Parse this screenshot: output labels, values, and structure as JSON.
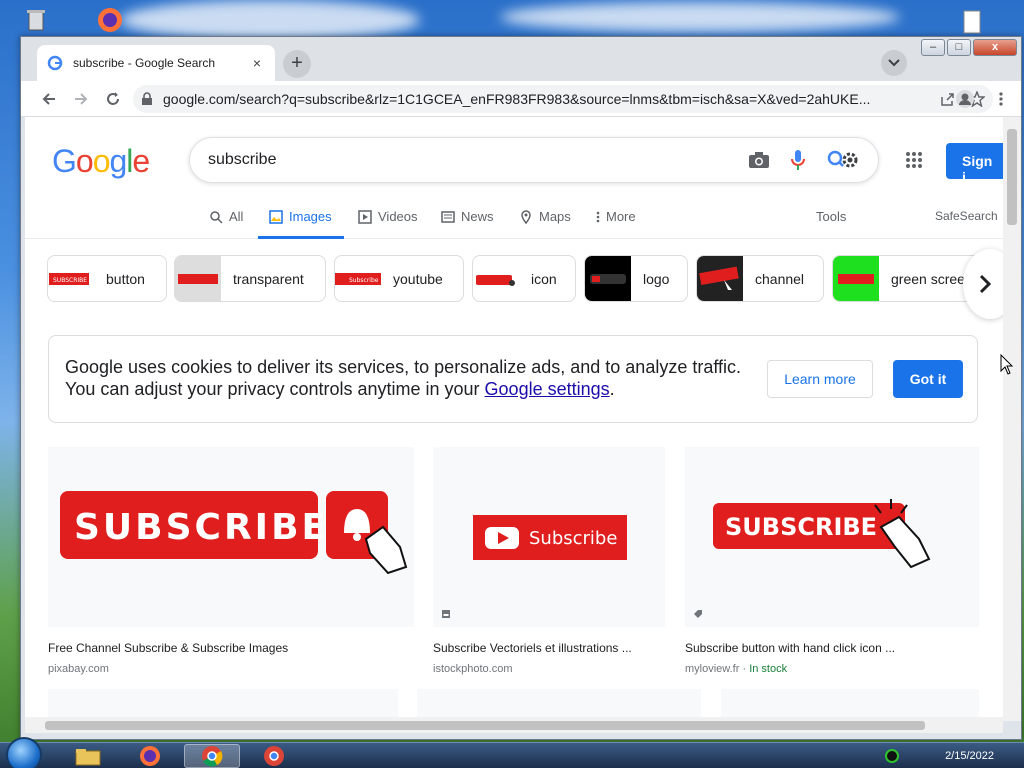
{
  "browser": {
    "tab_title": "subscribe - Google Search",
    "tab_close": "×",
    "new_tab": "+",
    "url": "google.com/search?q=subscribe&rlz=1C1GCEA_enFR983FR983&source=lnms&tbm=isch&sa=X&ved=2ahUKE..."
  },
  "google": {
    "logo_letters": [
      "G",
      "o",
      "o",
      "g",
      "l",
      "e"
    ],
    "logo_colors": [
      "#4285f4",
      "#ea4335",
      "#fbbc05",
      "#4285f4",
      "#34a853",
      "#ea4335"
    ],
    "query": "subscribe",
    "sign_in": "Sign i",
    "nav": {
      "all": "All",
      "images": "Images",
      "videos": "Videos",
      "news": "News",
      "maps": "Maps",
      "more": "More",
      "tools": "Tools",
      "safesearch": "SafeSearch"
    },
    "chips": [
      "button",
      "transparent",
      "youtube",
      "icon",
      "logo",
      "channel",
      "green scree"
    ],
    "cookie": {
      "line1": "Google uses cookies to deliver its services, to personalize ads, and to analyze traffic.",
      "line2_prefix": "You can adjust your privacy controls anytime in your ",
      "link": "Google settings",
      "line2_suffix": ".",
      "learn_more": "Learn more",
      "got_it": "Got it"
    },
    "results": [
      {
        "image_text": "SUBSCRIBED",
        "caption": "Free Channel Subscribe & Subscribe Images",
        "source": "pixabay.com",
        "extra": ""
      },
      {
        "image_text": "Subscribe",
        "caption": "Subscribe Vectoriels et illustrations ...",
        "source": "istockphoto.com",
        "extra": ""
      },
      {
        "image_text": "SUBSCRIBE",
        "caption": "Subscribe button with hand click icon ...",
        "source": "myloview.fr",
        "extra": "In stock"
      }
    ]
  },
  "colors": {
    "accent": "#1a73e8",
    "youtube_red": "#e01e1e"
  },
  "taskbar": {
    "time": "2/15/2022"
  }
}
